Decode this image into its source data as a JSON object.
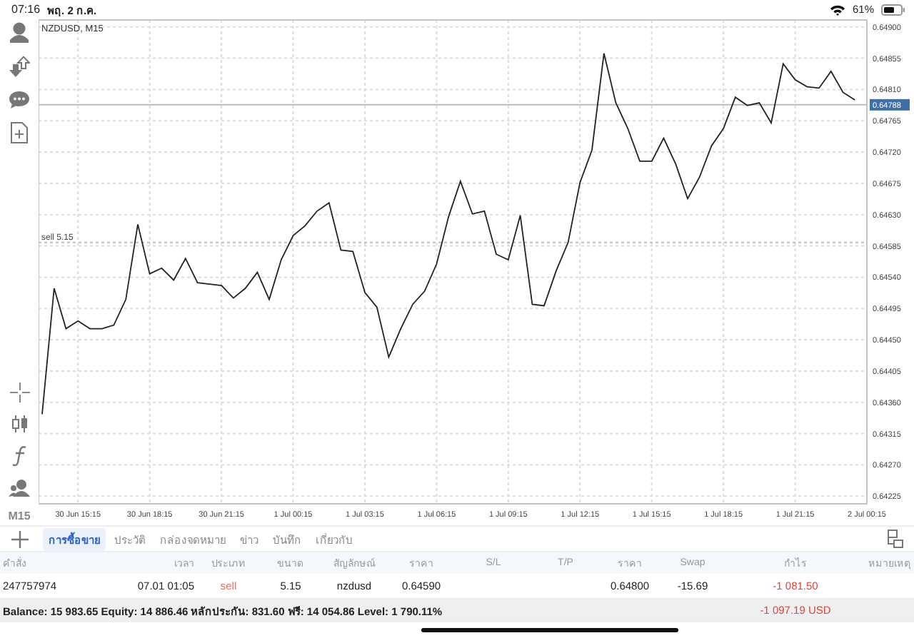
{
  "status_bar": {
    "time": "07:16",
    "date": "พฤ. 2 ก.ค.",
    "battery": "61%"
  },
  "toolbar": {
    "timeframe": "M15"
  },
  "chart": {
    "chart_data": {
      "type": "line",
      "title": "NZDUSD, M15",
      "categories": [
        null,
        null,
        null,
        "30 Jun 15:15",
        null,
        null,
        null,
        null,
        null,
        "30 Jun 18:15",
        null,
        null,
        null,
        null,
        null,
        "30 Jun 21:15",
        null,
        null,
        null,
        null,
        null,
        "1 Jul 00:15",
        null,
        null,
        null,
        null,
        null,
        "1 Jul 03:15",
        null,
        null,
        null,
        null,
        null,
        "1 Jul 06:15",
        null,
        null,
        null,
        null,
        null,
        "1 Jul 09:15",
        null,
        null,
        null,
        null,
        null,
        "1 Jul 12:15",
        null,
        null,
        null,
        null,
        null,
        "1 Jul 15:15",
        null,
        null,
        null,
        null,
        null,
        "1 Jul 18:15",
        null,
        null,
        null,
        null,
        null,
        "1 Jul 21:15",
        null,
        null,
        null,
        null,
        null,
        "2 Jul 00:15"
      ],
      "series": [
        {
          "color": "#222222",
          "values": [
            0.64343,
            0.64524,
            0.64466,
            0.64477,
            0.64466,
            0.64466,
            0.64471,
            0.64508,
            0.64616,
            0.64545,
            0.64553,
            0.64536,
            0.64567,
            0.64532,
            0.6453,
            0.64528,
            0.6451,
            0.64524,
            0.64547,
            0.64508,
            0.64565,
            0.646,
            0.64614,
            0.64635,
            0.64647,
            0.64579,
            0.64577,
            0.64518,
            0.64497,
            0.64425,
            0.64466,
            0.64501,
            0.6452,
            0.64559,
            0.64627,
            0.64678,
            0.64631,
            0.64635,
            0.64573,
            0.64565,
            0.64629,
            0.64501,
            0.64499,
            0.64549,
            0.6459,
            0.64676,
            0.64723,
            0.64862,
            0.64791,
            0.64754,
            0.64707,
            0.64707,
            0.6474,
            0.64703,
            0.64653,
            0.64684,
            0.64729,
            0.64754,
            0.64799,
            0.64787,
            0.64791,
            0.64762,
            0.64847,
            0.64824,
            0.64814,
            0.64812,
            0.64836,
            0.64806,
            0.64795,
            null
          ]
        }
      ],
      "ylim": [
        0.64214,
        0.6491
      ],
      "yticks": [
        {
          "value": 0.64225,
          "label": "0.64225"
        },
        {
          "value": 0.6427,
          "label": "0.64270"
        },
        {
          "value": 0.64315,
          "label": "0.64315"
        },
        {
          "value": 0.6436,
          "label": "0.64360"
        },
        {
          "value": 0.64405,
          "label": "0.64405"
        },
        {
          "value": 0.6445,
          "label": "0.64450"
        },
        {
          "value": 0.64495,
          "label": "0.64495"
        },
        {
          "value": 0.6454,
          "label": "0.64540"
        },
        {
          "value": 0.64585,
          "label": "0.64585"
        },
        {
          "value": 0.6463,
          "label": "0.64630"
        },
        {
          "value": 0.64675,
          "label": "0.64675"
        },
        {
          "value": 0.6472,
          "label": "0.64720"
        },
        {
          "value": 0.64765,
          "label": "0.64765"
        },
        {
          "value": 0.6481,
          "label": "0.64810"
        },
        {
          "value": 0.64855,
          "label": "0.64855"
        },
        {
          "value": 0.649,
          "label": "0.64900"
        }
      ],
      "grid": true,
      "ref_lines": [
        {
          "axis": "y",
          "value": 0.64788,
          "label": "0.64788"
        },
        {
          "axis": "y",
          "value": 0.6459,
          "label": "sell 5.15"
        }
      ]
    }
  },
  "tabs": [
    {
      "label": "การซื้อขาย",
      "selected": true
    },
    {
      "label": "ประวัติ",
      "selected": false
    },
    {
      "label": "กล่องจดหมาย",
      "selected": false
    },
    {
      "label": "ข่าว",
      "selected": false
    },
    {
      "label": "บันทึก",
      "selected": false
    },
    {
      "label": "เกี่ยวกับ",
      "selected": false
    }
  ],
  "table": {
    "columns": [
      "คำสั่ง",
      "เวลา",
      "ประเภท",
      "ขนาด",
      "สัญลักษณ์",
      "ราคา",
      "S/L",
      "T/P",
      "ราคา",
      "Swap",
      "กำไร",
      "หมายเหตุ"
    ],
    "rows": [
      {
        "cells": [
          {
            "text": "247757974"
          },
          {
            "text": "07.01 01:05"
          },
          {
            "text": "sell",
            "kind": "sell"
          },
          {
            "text": "5.15"
          },
          {
            "text": "nzdusd"
          },
          {
            "text": "0.64590"
          },
          {
            "text": ""
          },
          {
            "text": ""
          },
          {
            "text": "0.64800"
          },
          {
            "text": "-15.69"
          },
          {
            "text": "-1 081.50",
            "kind": "loss"
          },
          {
            "text": ""
          }
        ]
      }
    ]
  },
  "summary": {
    "text": "Balance: 15 983.65 Equity: 14 886.46 หลักประกัน: 831.60 ฟรี: 14 054.86 Level: 1 790.11%",
    "total": "-1 097.19  USD"
  }
}
